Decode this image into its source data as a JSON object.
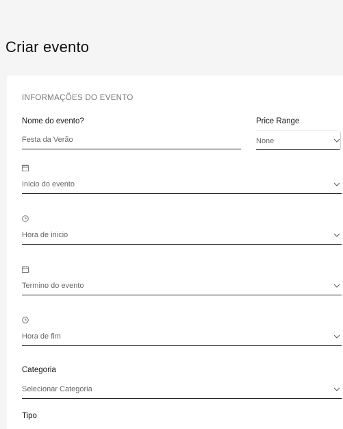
{
  "page": {
    "title": "Criar evento"
  },
  "form": {
    "section_title": "INFORMAÇÕES DO EVENTO",
    "event_name": {
      "label": "Nome do evento?",
      "value": "Festa da Verão"
    },
    "price_range": {
      "label": "Price Range",
      "selected": "None"
    },
    "start_date": {
      "icon": "calendar-icon",
      "value": "Inicio do evento"
    },
    "start_time": {
      "icon": "clock-icon",
      "value": "Hora de inicio"
    },
    "end_date": {
      "icon": "calendar-icon",
      "value": "Termino do evento"
    },
    "end_time": {
      "icon": "clock-icon",
      "value": "Hora de fim"
    },
    "category": {
      "label": "Categoria",
      "selected": "Selecionar Categoria"
    },
    "type": {
      "label": "Tipo"
    }
  }
}
